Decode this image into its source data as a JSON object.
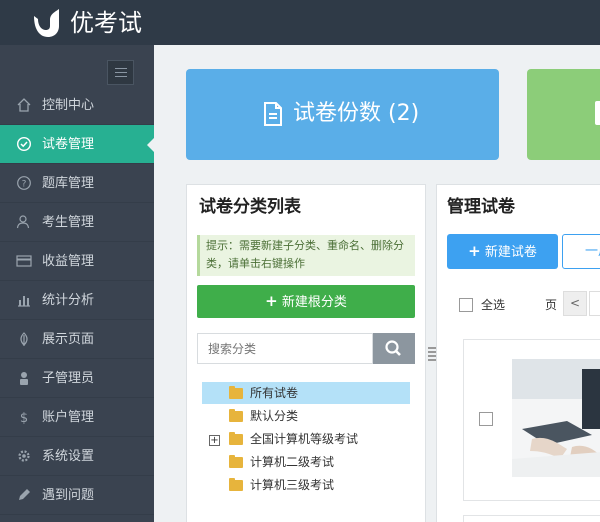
{
  "app": {
    "brand": "优考试"
  },
  "sidebar": {
    "toggle": "menu-toggle",
    "items": [
      {
        "label": "控制中心",
        "icon": "home-icon",
        "active": false
      },
      {
        "label": "试卷管理",
        "icon": "check-circle-icon",
        "active": true
      },
      {
        "label": "题库管理",
        "icon": "question-circle-icon",
        "active": false
      },
      {
        "label": "考生管理",
        "icon": "users-icon",
        "active": false
      },
      {
        "label": "收益管理",
        "icon": "credit-card-icon",
        "active": false
      },
      {
        "label": "统计分析",
        "icon": "bar-chart-icon",
        "active": false
      },
      {
        "label": "展示页面",
        "icon": "leaf-icon",
        "active": false
      },
      {
        "label": "子管理员",
        "icon": "user-lock-icon",
        "active": false
      },
      {
        "label": "账户管理",
        "icon": "dollar-icon",
        "active": false
      },
      {
        "label": "系统设置",
        "icon": "gear-icon",
        "active": false
      },
      {
        "label": "遇到问题",
        "icon": "pencil-icon",
        "active": false
      }
    ]
  },
  "stats": {
    "papers_label": "试卷份数 (2)"
  },
  "category_panel": {
    "title": "试卷分类列表",
    "hint": "提示：需要新建子分类、重命名、删除分类，请单击右键操作",
    "new_root_button": "新建根分类",
    "search_placeholder": "搜索分类",
    "tree": [
      {
        "label": "所有试卷",
        "selected": true,
        "expandable": false
      },
      {
        "label": "默认分类",
        "selected": false,
        "expandable": false
      },
      {
        "label": "全国计算机等级考试",
        "selected": false,
        "expandable": true
      },
      {
        "label": "计算机二级考试",
        "selected": false,
        "expandable": false
      },
      {
        "label": "计算机三级考试",
        "selected": false,
        "expandable": false
      }
    ]
  },
  "manage_panel": {
    "title": "管理试卷",
    "new_paper_button": "新建试卷",
    "batch_button_partial": "一用",
    "select_all": "全选",
    "page_label": "页",
    "prev_page": "<"
  },
  "colors": {
    "topbar": "#2f3a47",
    "sidebar": "#3a4350",
    "active": "#27b092",
    "card_blue": "#5aaee8",
    "card_green": "#8ccd79",
    "btn_green": "#3fae4a",
    "btn_blue": "#3da1f1"
  }
}
